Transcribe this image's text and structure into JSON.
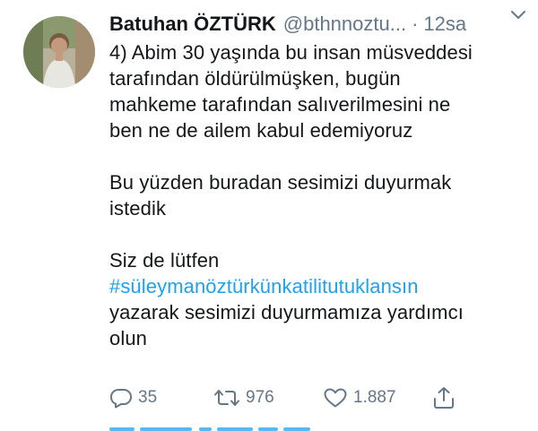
{
  "tweet": {
    "author": {
      "name": "Batuhan ÖZTÜRK",
      "handle": "@bthnnoztu...",
      "separator": "·",
      "time": "12sa"
    },
    "text_lines": [
      "4) Abim 30 yaşında bu insan müsveddesi",
      "tarafından öldürülmüşken, bugün",
      "mahkeme tarafından salıverilmesini ne",
      "ben ne de ailem kabul edemiyoruz",
      "Bu yüzden buradan sesimizi duyurmak",
      "istedik",
      "Siz de lütfen"
    ],
    "hashtag": "#süleymanöztürkünkatilitutuklansın",
    "text_after": [
      "yazarak sesimizi duyurmamıza yardımcı",
      "olun"
    ],
    "stats": {
      "replies": "35",
      "retweets": "976",
      "likes": "1.887"
    },
    "icons": {
      "reply": "reply-icon",
      "retweet": "retweet-icon",
      "like": "heart-icon",
      "share": "share-icon",
      "menu": "chevron-down-icon"
    },
    "colors": {
      "link": "#1da1f2",
      "secondary": "#657786",
      "text": "#14171a"
    }
  }
}
